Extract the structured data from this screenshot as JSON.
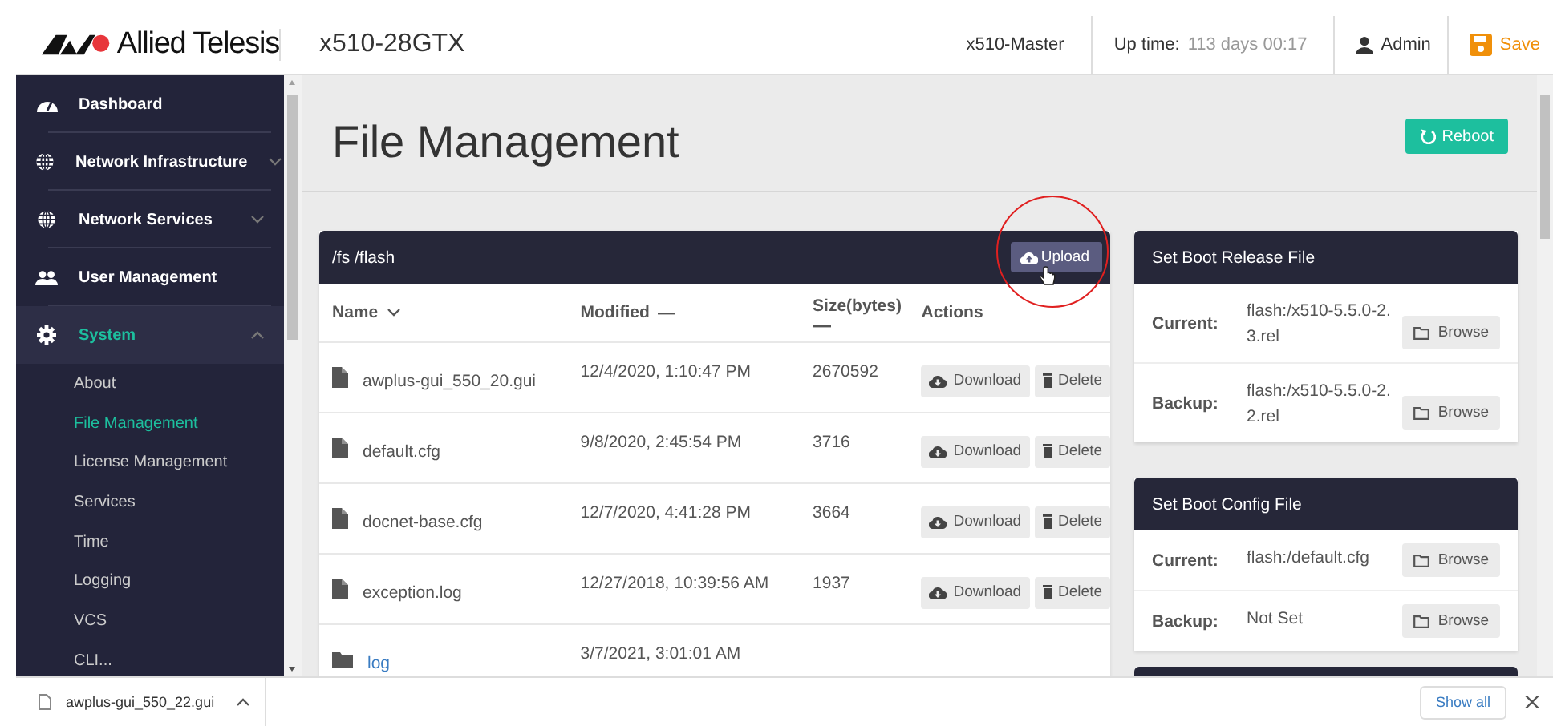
{
  "header": {
    "brand": "Allied Telesis",
    "device": "x510-28GTX",
    "stack": "x510-Master",
    "uptime_label": "Up time:",
    "uptime_value": "113 days 00:17",
    "user": "Admin",
    "save": "Save"
  },
  "sidebar": {
    "items": [
      {
        "label": "Dashboard",
        "selected": false
      },
      {
        "label": "Network Infrastructure",
        "expanded": false,
        "selected": false
      },
      {
        "label": "Network Services",
        "expanded": false,
        "selected": false
      },
      {
        "label": "User Management",
        "selected": false
      },
      {
        "label": "System",
        "expanded": true,
        "selected": true,
        "children": [
          {
            "label": "About",
            "selected": false
          },
          {
            "label": "File Management",
            "selected": true
          },
          {
            "label": "License Management",
            "selected": false
          },
          {
            "label": "Services",
            "selected": false
          },
          {
            "label": "Time",
            "selected": false
          },
          {
            "label": "Logging",
            "selected": false
          },
          {
            "label": "VCS",
            "selected": false
          },
          {
            "label": "CLI...",
            "selected": false
          }
        ]
      }
    ]
  },
  "page": {
    "title": "File Management",
    "reboot": "Reboot"
  },
  "file_panel": {
    "path": "/fs /flash",
    "upload": "Upload",
    "columns": [
      {
        "label": "Name",
        "sorted": true
      },
      {
        "label": "Modified",
        "sorted": false
      },
      {
        "label": "Size(bytes)",
        "sorted": false
      },
      {
        "label": "Actions"
      }
    ],
    "rows": [
      {
        "kind": "file",
        "name": "awplus-gui_550_20.gui",
        "modified": "12/4/2020, 1:10:47 PM",
        "size": "2670592",
        "actions": [
          "Download",
          "Delete"
        ]
      },
      {
        "kind": "file",
        "name": "default.cfg",
        "modified": "9/8/2020, 2:45:54 PM",
        "size": "3716",
        "actions": [
          "Download",
          "Delete"
        ]
      },
      {
        "kind": "file",
        "name": "docnet-base.cfg",
        "modified": "12/7/2020, 4:41:28 PM",
        "size": "3664",
        "actions": [
          "Download",
          "Delete"
        ]
      },
      {
        "kind": "file",
        "name": "exception.log",
        "modified": "12/27/2018, 10:39:56 AM",
        "size": "1937",
        "actions": [
          "Download",
          "Delete"
        ]
      },
      {
        "kind": "folder",
        "name": "log",
        "modified": "3/7/2021, 3:01:01 AM"
      }
    ]
  },
  "boot_panels": [
    {
      "title": "Set Boot Release File",
      "fields": [
        {
          "label": "Current:",
          "value": "flash:/x510-5.5.0-2.3.rel",
          "button": "Browse"
        },
        {
          "label": "Backup:",
          "value": "flash:/x510-5.5.0-2.2.rel",
          "button": "Browse"
        }
      ]
    },
    {
      "title": "Set Boot Config File",
      "fields": [
        {
          "label": "Current:",
          "value": "flash:/default.cfg",
          "button": "Browse"
        },
        {
          "label": "Backup:",
          "value": "Not Set",
          "button": "Browse"
        }
      ]
    }
  ],
  "download_bar": {
    "file": "awplus-gui_550_22.gui",
    "show_all": "Show all"
  }
}
